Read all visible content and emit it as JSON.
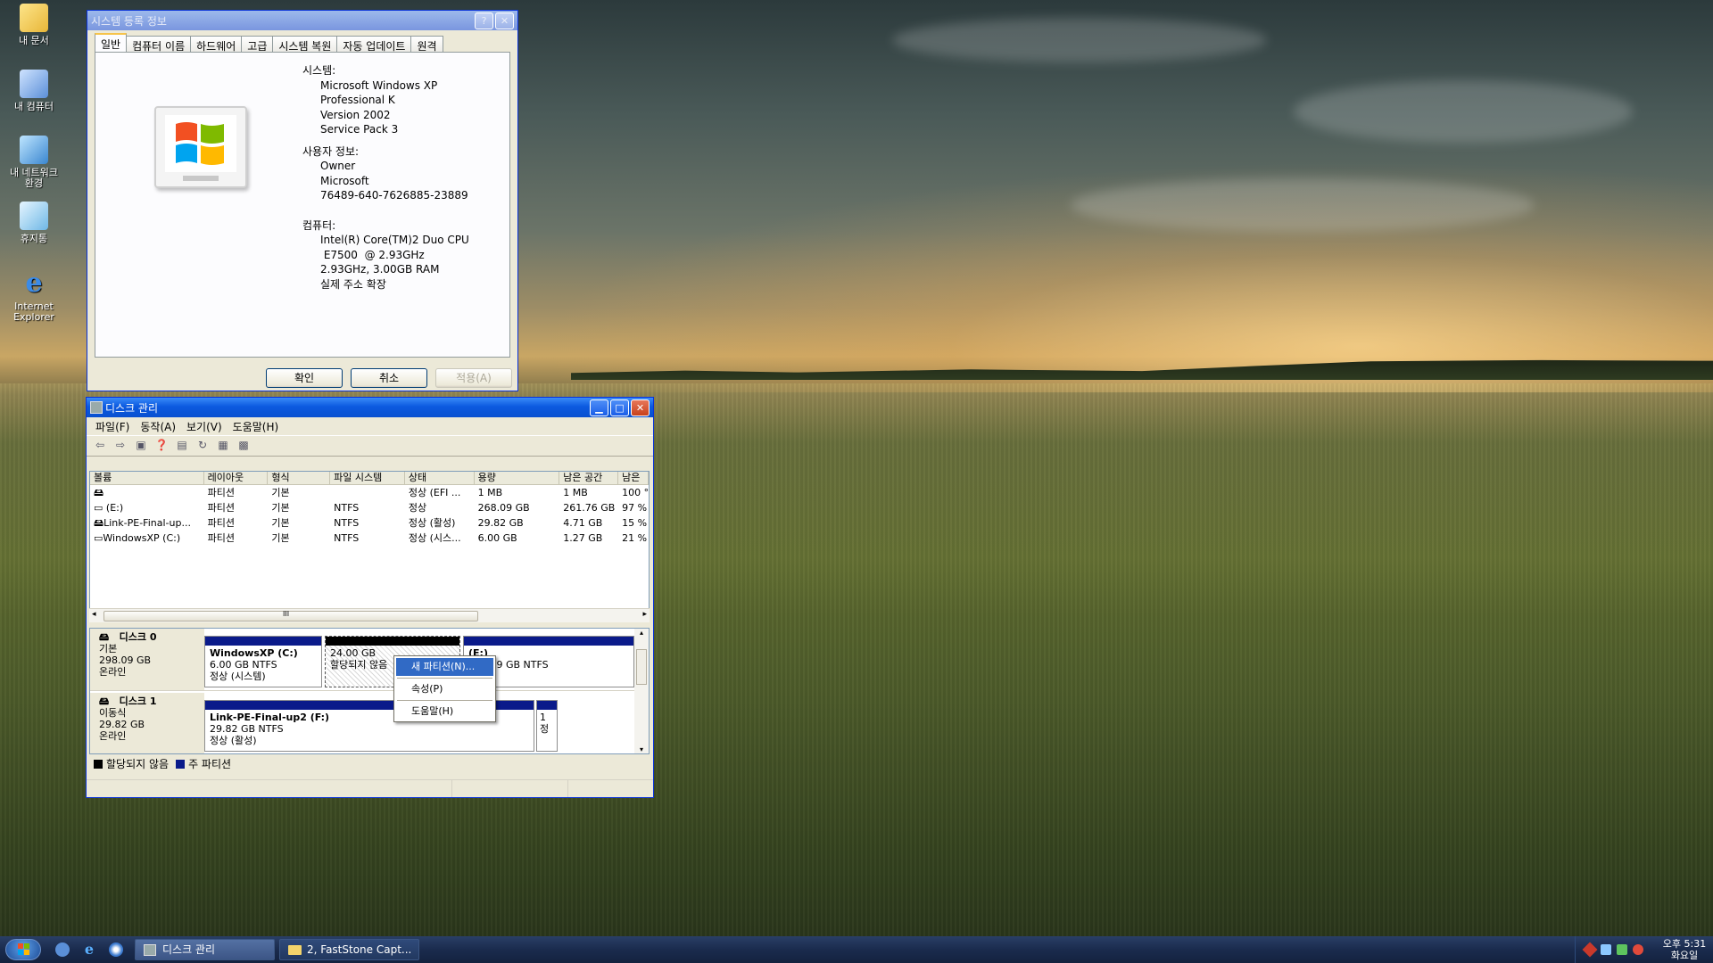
{
  "desktop": {
    "icons": [
      {
        "label": "내 문서",
        "icon": "my-documents-icon"
      },
      {
        "label": "내 컴퓨터",
        "icon": "my-computer-icon"
      },
      {
        "label": "내 네트워크 환경",
        "icon": "network-icon"
      },
      {
        "label": "휴지통",
        "icon": "recycle-bin-icon"
      },
      {
        "label": "Internet Explorer",
        "icon": "internet-explorer-icon"
      }
    ]
  },
  "sysprops": {
    "title": "시스템 등록 정보",
    "help_btn": "?",
    "close_btn": "✕",
    "tabs": [
      "일반",
      "컴퓨터 이름",
      "하드웨어",
      "고급",
      "시스템 복원",
      "자동 업데이트",
      "원격"
    ],
    "system_label": "시스템:",
    "system": [
      "Microsoft Windows XP",
      "Professional K",
      "Version 2002",
      "Service Pack 3"
    ],
    "user_label": "사용자 정보:",
    "user": [
      "Owner",
      "Microsoft",
      "76489-640-7626885-23889"
    ],
    "computer_label": "컴퓨터:",
    "computer": [
      "Intel(R) Core(TM)2 Duo CPU",
      " E7500  @ 2.93GHz",
      "2.93GHz, 3.00GB RAM",
      "실제 주소 확장"
    ],
    "ok": "확인",
    "cancel": "취소",
    "apply": "적용(A)"
  },
  "diskmgmt": {
    "title": "디스크 관리",
    "min_btn": "▁",
    "max_btn": "□",
    "close_btn": "✕",
    "menu": [
      "파일(F)",
      "동작(A)",
      "보기(V)",
      "도움말(H)"
    ],
    "columns": [
      "볼륨",
      "레이아웃",
      "형식",
      "파일 시스템",
      "상태",
      "용량",
      "남은 공간",
      "남은"
    ],
    "rows": [
      [
        "",
        "파티션",
        "기본",
        "",
        "정상 (EFI ...",
        "1 MB",
        "1 MB",
        "100 °"
      ],
      [
        "(E:)",
        "파티션",
        "기본",
        "NTFS",
        "정상",
        "268.09 GB",
        "261.76 GB",
        "97 %"
      ],
      [
        "Link-PE-Final-up...",
        "파티션",
        "기본",
        "NTFS",
        "정상 (활성)",
        "29.82 GB",
        "4.71 GB",
        "15 %"
      ],
      [
        "WindowsXP (C:)",
        "파티션",
        "기본",
        "NTFS",
        "정상 (시스...",
        "6.00 GB",
        "1.27 GB",
        "21 %"
      ]
    ],
    "scroll_grip": "III",
    "disks": [
      {
        "name": "디스크 0",
        "type": "기본",
        "size": "298.09 GB",
        "status": "온라인",
        "parts": [
          {
            "title": "WindowsXP  (C:)",
            "l2": "6.00 GB NTFS",
            "l3": "정상 (시스템)"
          },
          {
            "title": "",
            "l2": "24.00 GB",
            "l3": "할당되지 않음"
          },
          {
            "title": "(E:)",
            "l2": "268.09 GB NTFS",
            "l3": ""
          }
        ]
      },
      {
        "name": "디스크 1",
        "type": "이동식",
        "size": "29.82 GB",
        "status": "온라인",
        "parts": [
          {
            "title": "Link-PE-Final-up2  (F:)",
            "l2": "29.82 GB NTFS",
            "l3": "정상 (활성)"
          },
          {
            "title": "",
            "l2": "1",
            "l3": "정"
          }
        ]
      }
    ],
    "legend": [
      "할당되지 않음",
      "주 파티션"
    ],
    "context_menu": [
      "새 파티션(N)...",
      "속성(P)",
      "도움말(H)"
    ]
  },
  "taskbar": {
    "tasks": [
      "디스크 관리",
      "2, FastStone Capt..."
    ],
    "time": "오후 5:31",
    "day": "화요일"
  },
  "colors": {
    "xp_blue": "#0c5ae0",
    "primary_partition": "#0a1a8a",
    "unallocated": "#000000"
  }
}
